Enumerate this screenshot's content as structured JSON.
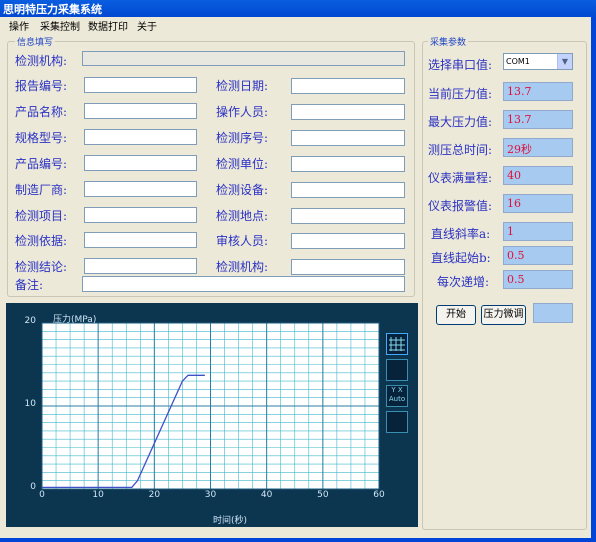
{
  "window": {
    "title": "思明特压力采集系统"
  },
  "menu": [
    "操作",
    "采集控制",
    "数据打印",
    "关于"
  ],
  "info": {
    "group_title": "信息填写",
    "org_label": "检测机构:",
    "left_labels": [
      "报告编号:",
      "产品名称:",
      "规格型号:",
      "产品编号:",
      "制造厂商:",
      "检测项目:",
      "检测依据:",
      "检测结论:"
    ],
    "right_labels": [
      "检测日期:",
      "操作人员:",
      "检测序号:",
      "检测单位:",
      "检测设备:",
      "检测地点:",
      "审核人员:",
      "检测机构:"
    ],
    "remark_label": "备注:"
  },
  "params": {
    "group_title": "采集参数",
    "port_label": "选择串口值:",
    "port_value": "COM1",
    "rows": [
      {
        "label": "当前压力值:",
        "value": "13.7"
      },
      {
        "label": "最大压力值:",
        "value": "13.7"
      },
      {
        "label": "测压总时间:",
        "value": "29秒"
      },
      {
        "label": "仪表满量程:",
        "value": "40"
      },
      {
        "label": "仪表报警值:",
        "value": "16"
      },
      {
        "label": "直线斜率a:",
        "value": "1"
      },
      {
        "label": "直线起始b:",
        "value": "0.5"
      },
      {
        "label": "每次递增:",
        "value": "0.5"
      }
    ],
    "start_button": "开始",
    "calibrate_button": "压力微调"
  },
  "chart_data": {
    "type": "line",
    "ylabel": "压力(MPa)",
    "xlabel": "时间(秒)",
    "xlim": [
      0,
      60
    ],
    "ylim": [
      0,
      20
    ],
    "x_ticks": [
      0,
      10,
      20,
      30,
      40,
      50,
      60
    ],
    "y_ticks": [
      0,
      10,
      20
    ],
    "grid": true,
    "series": [
      {
        "x": [
          0,
          3,
          4,
          16,
          17,
          25,
          26,
          29
        ],
        "y": [
          0.2,
          0.2,
          0.2,
          0.2,
          1.0,
          13.0,
          13.7,
          13.7
        ]
      }
    ],
    "colors": {
      "line": "#4050c8",
      "grid": "#40b8cc",
      "plot_bg": "#ffffff"
    },
    "tools": [
      {
        "icon": "grid-icon",
        "text": ""
      },
      {
        "icon": "zoom-icon",
        "text": ""
      },
      {
        "icon": "autoscale-icon",
        "text": "Y X Auto"
      },
      {
        "icon": "pan-icon",
        "text": ""
      }
    ]
  }
}
